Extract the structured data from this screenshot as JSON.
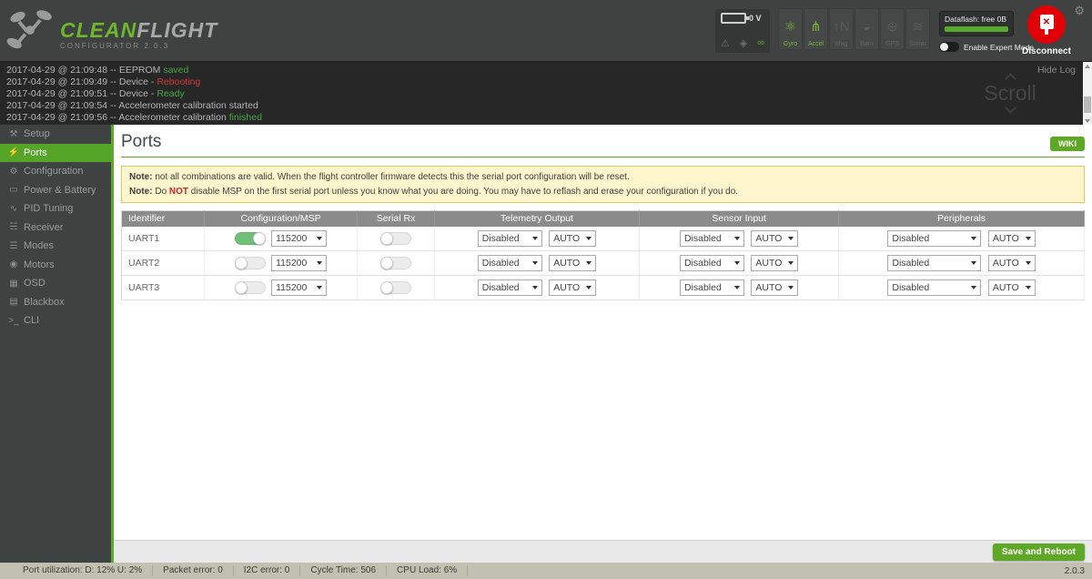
{
  "colors": {
    "accent_green": "#5fa827",
    "nav_active_green": "#55a528",
    "toggle_on_green": "#6fc177",
    "log_green": "#46a546",
    "log_red": "#cf3a3a",
    "note_bg": "#fff6ce",
    "disconnect_red": "#e00005"
  },
  "header": {
    "logo_title_1": "CLEAN",
    "logo_title_2": "FLIGHT",
    "logo_subtitle": "CONFIGURATOR  2.0.3",
    "battery_voltage": "0 V",
    "warning_icon_glyph": "⚠",
    "signal_icon_glyph": "◈",
    "link_icon_glyph": "∞",
    "gear_icon_glyph": "⚙",
    "sensors": [
      {
        "label": "Gyro",
        "glyph": "⚛",
        "active": true
      },
      {
        "label": "Accel",
        "glyph": "⋔",
        "active": true
      },
      {
        "label": "Mag",
        "glyph": "↑N",
        "active": false
      },
      {
        "label": "Baro",
        "glyph": "◒",
        "active": false
      },
      {
        "label": "GPS",
        "glyph": "⊕",
        "active": false
      },
      {
        "label": "Sonar",
        "glyph": "≋",
        "active": false
      }
    ],
    "dataflash_label": "Dataflash: free 0B",
    "expert_mode_label": "Enable Expert Mode",
    "expert_mode_state": "off",
    "disconnect_label": "Disconnect",
    "disconnect_icon_glyph": "✕"
  },
  "log": {
    "hide_label": "Hide Log",
    "scroll_label": "Scroll",
    "entries": [
      {
        "text": "2017-04-29 @ 21:09:48 -- EEPROM ",
        "status": "saved",
        "status_class": "st-green"
      },
      {
        "text": "2017-04-29 @ 21:09:49 -- Device - ",
        "status": "Rebooting",
        "status_class": "st-red"
      },
      {
        "text": "2017-04-29 @ 21:09:51 -- Device - ",
        "status": "Ready",
        "status_class": "st-green"
      },
      {
        "text": "2017-04-29 @ 21:09:54 -- Accelerometer calibration started",
        "status": "",
        "status_class": "st-plain"
      },
      {
        "text": "2017-04-29 @ 21:09:56 -- Accelerometer calibration ",
        "status": "finished",
        "status_class": "st-green"
      }
    ]
  },
  "sidebar": {
    "items": [
      {
        "label": "Setup",
        "glyph": "⚒",
        "active": false
      },
      {
        "label": "Ports",
        "glyph": "⚡",
        "active": true
      },
      {
        "label": "Configuration",
        "glyph": "⚙",
        "active": false
      },
      {
        "label": "Power & Battery",
        "glyph": "▭",
        "active": false
      },
      {
        "label": "PID Tuning",
        "glyph": "∿",
        "active": false
      },
      {
        "label": "Receiver",
        "glyph": "☵",
        "active": false
      },
      {
        "label": "Modes",
        "glyph": "☰",
        "active": false
      },
      {
        "label": "Motors",
        "glyph": "◉",
        "active": false
      },
      {
        "label": "OSD",
        "glyph": "▦",
        "active": false
      },
      {
        "label": "Blackbox",
        "glyph": "▤",
        "active": false
      },
      {
        "label": "CLI",
        "glyph": ">_",
        "active": false
      }
    ]
  },
  "main": {
    "title": "Ports",
    "wiki_label": "WIKI",
    "note1_label": "Note:",
    "note1_text": " not all combinations are valid. When the flight controller firmware detects this the serial port configuration will be reset.",
    "note2_label": "Note:",
    "note2_pre": " Do ",
    "note2_em": "NOT",
    "note2_post": " disable MSP on the first serial port unless you know what you are doing. You may have to reflash and erase your configuration if you do.",
    "table": {
      "headers": [
        "Identifier",
        "Configuration/MSP",
        "Serial Rx",
        "Telemetry Output",
        "Sensor Input",
        "Peripherals"
      ],
      "rows": [
        {
          "identifier": "UART1",
          "msp_state": "on",
          "baud": "115200",
          "serial_rx_state": "off",
          "telemetry": "Disabled",
          "telemetry_speed": "AUTO",
          "sensor": "Disabled",
          "sensor_speed": "AUTO",
          "peripherals": "Disabled",
          "peripherals_speed": "AUTO"
        },
        {
          "identifier": "UART2",
          "msp_state": "off",
          "baud": "115200",
          "serial_rx_state": "off",
          "telemetry": "Disabled",
          "telemetry_speed": "AUTO",
          "sensor": "Disabled",
          "sensor_speed": "AUTO",
          "peripherals": "Disabled",
          "peripherals_speed": "AUTO"
        },
        {
          "identifier": "UART3",
          "msp_state": "off",
          "baud": "115200",
          "serial_rx_state": "off",
          "telemetry": "Disabled",
          "telemetry_speed": "AUTO",
          "sensor": "Disabled",
          "sensor_speed": "AUTO",
          "peripherals": "Disabled",
          "peripherals_speed": "AUTO"
        }
      ]
    },
    "save_button": "Save and Reboot"
  },
  "statusbar": {
    "cells": [
      "Port utilization: D: 12% U: 2%",
      "Packet error: 0",
      "I2C error: 0",
      "Cycle Time: 506",
      "CPU Load: 6%"
    ],
    "version": "2.0.3"
  }
}
